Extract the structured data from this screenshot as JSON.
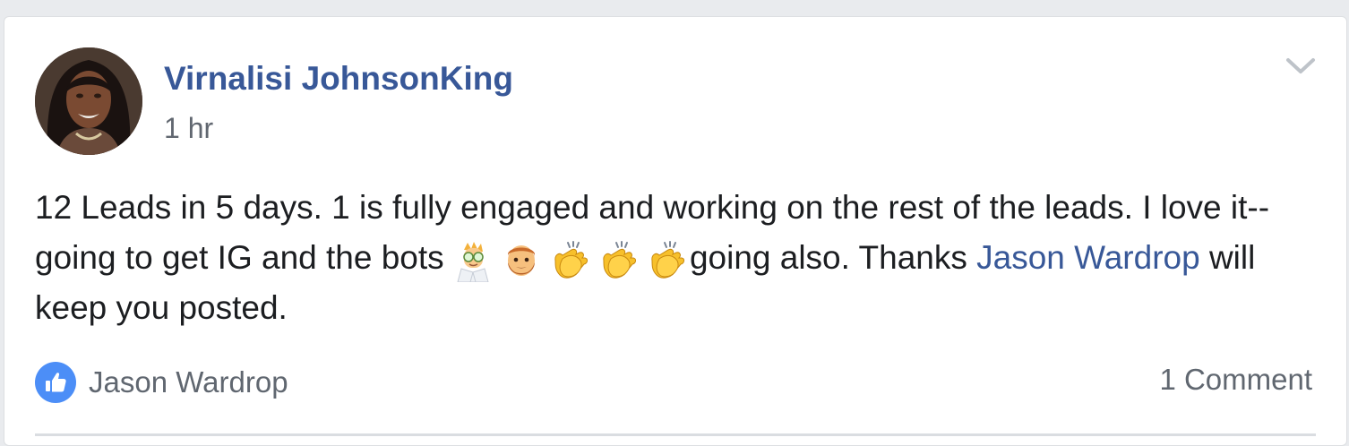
{
  "post": {
    "author": "Virnalisi JohnsonKing",
    "timestamp": "1 hr",
    "text_before_emoji": "12 Leads in 5 days. 1 is fully engaged and working on the rest of the leads. I love it--going to get IG and the bots ",
    "emojis": [
      "scientist-emoji",
      "bearded-man-emoji",
      "clapping-hands-emoji",
      "clapping-hands-emoji",
      "clapping-hands-emoji"
    ],
    "text_after_emoji": "going also. Thanks ",
    "mention": "Jason Wardrop",
    "text_end": " will keep you posted."
  },
  "reactions": {
    "type": "like",
    "names": "Jason Wardrop"
  },
  "comments": {
    "count_label": "1 Comment"
  },
  "colors": {
    "link": "#385898",
    "text": "#1c1e21",
    "meta": "#616770",
    "like_badge": "#4c8ef7",
    "card_bg": "#ffffff",
    "page_bg": "#e9ebee"
  }
}
